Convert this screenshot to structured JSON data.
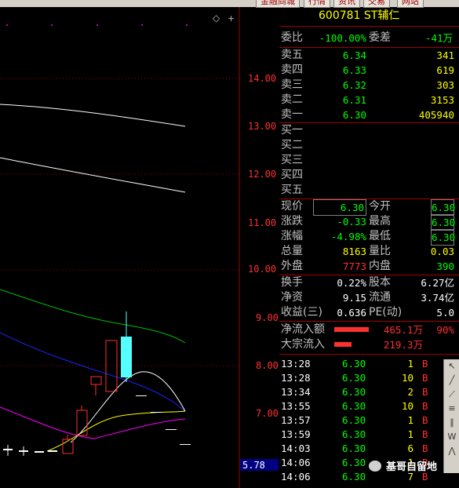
{
  "top_buttons": [
    "金融商城",
    "行情",
    "资讯",
    "交易",
    "网站"
  ],
  "stock": {
    "code_name": "600781 ST辅仁"
  },
  "weibi": {
    "label1": "委比",
    "value1": "-100.00%",
    "label2": "委差",
    "value2": "-41万"
  },
  "asks": [
    {
      "label": "卖五",
      "price": "6.34",
      "vol": "341"
    },
    {
      "label": "卖四",
      "price": "6.33",
      "vol": "619"
    },
    {
      "label": "卖三",
      "price": "6.32",
      "vol": "303"
    },
    {
      "label": "卖二",
      "price": "6.31",
      "vol": "3153"
    },
    {
      "label": "卖一",
      "price": "6.30",
      "vol": "405940"
    }
  ],
  "bids": [
    "买一",
    "买二",
    "买三",
    "买四",
    "买五"
  ],
  "stats": [
    {
      "l1": "现价",
      "v1": "6.30",
      "l2": "今开",
      "v2": "6.30"
    },
    {
      "l1": "涨跌",
      "v1": "-0.33",
      "l2": "最高",
      "v2": "6.30"
    },
    {
      "l1": "涨幅",
      "v1": "-4.98%",
      "l2": "最低",
      "v2": "6.30"
    },
    {
      "l1": "总量",
      "v1": "8163",
      "l2": "量比",
      "v2": "0.03"
    },
    {
      "l1": "外盘",
      "v1": "7773",
      "l2": "内盘",
      "v2": "390"
    }
  ],
  "fund": [
    {
      "l1": "换手",
      "v1": "0.22%",
      "l2": "股本",
      "v2": "6.27亿"
    },
    {
      "l1": "净资",
      "v1": "9.15",
      "l2": "流通",
      "v2": "3.74亿"
    },
    {
      "l1": "收益(三)",
      "v1": "0.636",
      "l2": "PE(动)",
      "v2": "5.0"
    }
  ],
  "flow": [
    {
      "label": "净流入额",
      "value": "465.1万",
      "pct": "90%"
    },
    {
      "label": "大宗流入",
      "value": "219.3万"
    }
  ],
  "ticks": [
    {
      "time": "13:28",
      "price": "6.30",
      "vol": "1",
      "side": "B"
    },
    {
      "time": "13:28",
      "price": "6.30",
      "vol": "10",
      "side": "B"
    },
    {
      "time": "13:34",
      "price": "6.30",
      "vol": "2",
      "side": "B"
    },
    {
      "time": "13:55",
      "price": "6.30",
      "vol": "10",
      "side": "B"
    },
    {
      "time": "13:57",
      "price": "6.30",
      "vol": "1",
      "side": "B"
    },
    {
      "time": "13:59",
      "price": "6.30",
      "vol": "1",
      "side": "B"
    },
    {
      "time": "14:03",
      "price": "6.30",
      "vol": "6",
      "side": "B"
    },
    {
      "time": "14:06",
      "price": "6.30",
      "vol": "1",
      "side": "B"
    },
    {
      "time": "14:06",
      "price": "6.30",
      "vol": "7",
      "side": "B"
    }
  ],
  "price_axis": [
    "14.00",
    "13.00",
    "12.00",
    "11.00",
    "10.00",
    "9.00",
    "8.00",
    "7.00"
  ],
  "current_price_tag": "5.78",
  "watermark": "基哥自留地",
  "colors": {
    "up": "#ff3030",
    "down": "#54ffff",
    "ma_white": "#ffffff",
    "ma_yellow": "#ffff00",
    "ma_magenta": "#ff00ff",
    "ma_green": "#00c000",
    "ma_blue": "#0000ff",
    "grid": "#a00000"
  }
}
